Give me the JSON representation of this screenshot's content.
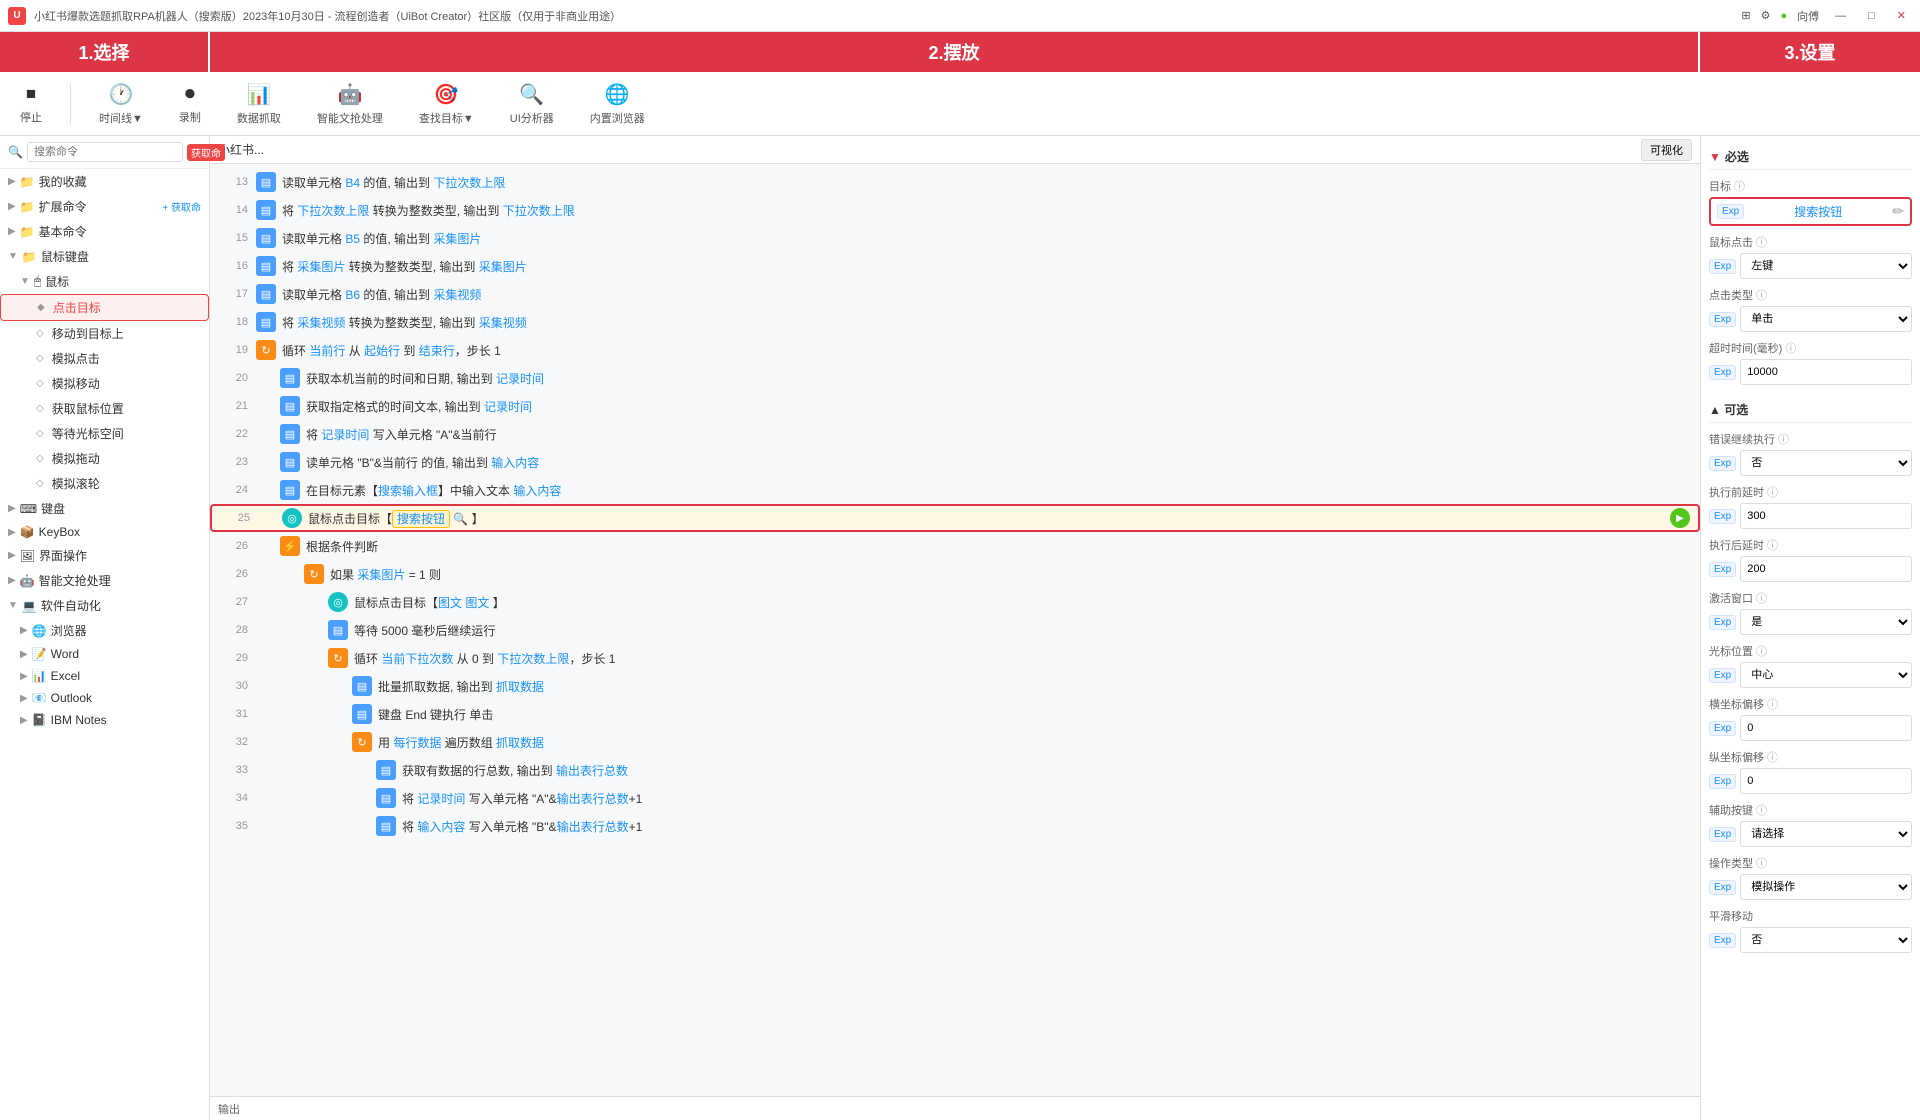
{
  "titlebar": {
    "icon": "U",
    "title": "小红书爆款选题抓取RPA机器人（搜索版）2023年10月30日 - 流程创造者（UiBot Creator）社区版（仅用于非商业用途）",
    "controls": [
      "最小化",
      "最大化",
      "关闭"
    ],
    "right": {
      "grid_icon": "⊞",
      "user": "向傅",
      "dot_color": "#52c41a"
    }
  },
  "toolbar": {
    "items": [
      {
        "id": "stop",
        "label": "停止",
        "icon": "⏹"
      },
      {
        "id": "time",
        "label": "时间线▼",
        "icon": "🕐"
      },
      {
        "id": "record",
        "label": "录制",
        "icon": "⏺"
      },
      {
        "id": "extract",
        "label": "数据抓取",
        "icon": "📊"
      },
      {
        "id": "ai_text",
        "label": "智能文抢处理",
        "icon": "🤖"
      },
      {
        "id": "find_target",
        "label": "查找目标▼",
        "icon": "🎯"
      },
      {
        "id": "ui_analyzer",
        "label": "UI分析器",
        "icon": "🔍"
      },
      {
        "id": "browser",
        "label": "内置浏览器",
        "icon": "🌐"
      }
    ]
  },
  "left_panel": {
    "search_placeholder": "搜索命令",
    "badge": "获取命",
    "sections": [
      {
        "id": "favorites",
        "label": "我的收藏",
        "level": 0,
        "collapsed": true
      },
      {
        "id": "extensions",
        "label": "扩展命令",
        "level": 0,
        "collapsed": true
      },
      {
        "id": "basic",
        "label": "基本命令",
        "level": 0,
        "collapsed": true
      },
      {
        "id": "mouse_keyboard",
        "label": "鼠标键盘",
        "level": 0,
        "collapsed": false
      },
      {
        "id": "mouse",
        "label": "鼠标",
        "level": 1,
        "collapsed": false
      },
      {
        "id": "click_target",
        "label": "点击目标",
        "level": 2,
        "active": true
      },
      {
        "id": "move_to_target",
        "label": "移动到目标上",
        "level": 2
      },
      {
        "id": "simulate_click",
        "label": "模拟点击",
        "level": 2
      },
      {
        "id": "simulate_move",
        "label": "模拟移动",
        "level": 2
      },
      {
        "id": "get_mouse_pos",
        "label": "获取鼠标位置",
        "level": 2
      },
      {
        "id": "wait_cursor",
        "label": "等待光标空间",
        "level": 2
      },
      {
        "id": "simulate_drag",
        "label": "模拟拖动",
        "level": 2
      },
      {
        "id": "simulate_scroll",
        "label": "模拟滚轮",
        "level": 2
      },
      {
        "id": "keyboard",
        "label": "键盘",
        "level": 0,
        "collapsed": true
      },
      {
        "id": "keybox",
        "label": "KeyBox",
        "level": 0,
        "collapsed": true
      },
      {
        "id": "ui_ops",
        "label": "界面操作",
        "level": 0,
        "collapsed": true
      },
      {
        "id": "ai_text2",
        "label": "智能文抢处理",
        "level": 0,
        "collapsed": true
      },
      {
        "id": "software_auto",
        "label": "软件自动化",
        "level": 0,
        "collapsed": false
      },
      {
        "id": "browser2",
        "label": "浏览器",
        "level": 1,
        "collapsed": true
      },
      {
        "id": "word",
        "label": "Word",
        "level": 1,
        "collapsed": true
      },
      {
        "id": "excel",
        "label": "Excel",
        "level": 1,
        "collapsed": true
      },
      {
        "id": "outlook",
        "label": "Outlook",
        "level": 1,
        "collapsed": true
      },
      {
        "id": "ibm_notes",
        "label": "IBM Notes",
        "level": 1,
        "collapsed": true
      }
    ],
    "section_label": "1.选择"
  },
  "center_panel": {
    "breadcrumb": "小红书...",
    "vis_btn": "可视化",
    "section_label": "2.摆放",
    "rows": [
      {
        "num": 13,
        "icon_type": "blue",
        "icon": "▤",
        "content": "读取单元格 B4 的值, 输出到 下拉次数上限",
        "vars": [
          "B4",
          "下拉次数上限"
        ]
      },
      {
        "num": 14,
        "icon_type": "blue",
        "icon": "▤",
        "content": "将 下拉次数上限 转换为整数类型, 输出到 下拉次数上限",
        "vars": [
          "下拉次数上限",
          "下拉次数上限"
        ]
      },
      {
        "num": 15,
        "icon_type": "blue",
        "icon": "▤",
        "content": "读取单元格 B5 的值, 输出到 采集图片",
        "vars": [
          "B5",
          "采集图片"
        ]
      },
      {
        "num": 16,
        "icon_type": "blue",
        "icon": "▤",
        "content": "将 采集图片 转换为整数类型, 输出到 采集图片",
        "vars": [
          "采集图片",
          "采集图片"
        ]
      },
      {
        "num": 17,
        "icon_type": "blue",
        "icon": "▤",
        "content": "读取单元格 B6 的值, 输出到 采集视频",
        "vars": [
          "B6",
          "采集视频"
        ]
      },
      {
        "num": 18,
        "icon_type": "blue",
        "icon": "▤",
        "content": "将 采集视频 转换为整数类型, 输出到 采集视频",
        "vars": [
          "采集视频",
          "采集视频"
        ]
      },
      {
        "num": 19,
        "icon_type": "orange",
        "icon": "↻",
        "content": "循环 当前行 从 起始行 到 结束行，步长 1",
        "vars": [
          "当前行",
          "起始行",
          "结束行"
        ]
      },
      {
        "num": 20,
        "icon_type": "blue",
        "icon": "▤",
        "content": "获取本机当前的时间和日期, 输出到 记录时间",
        "indent": 1,
        "vars": [
          "记录时间"
        ]
      },
      {
        "num": 21,
        "icon_type": "blue",
        "icon": "▤",
        "content": "获取指定格式的时间文本, 输出到 记录时间",
        "indent": 1,
        "vars": [
          "记录时间"
        ]
      },
      {
        "num": 22,
        "icon_type": "blue",
        "icon": "▤",
        "content": "将 记录时间 写入单元格 \"A\"&当前行",
        "indent": 1,
        "vars": [
          "记录时间",
          "A",
          "当前行"
        ]
      },
      {
        "num": 23,
        "icon_type": "blue",
        "icon": "▤",
        "content": "读单元格 \"B\"&当前行 的值, 输出到 输入内容",
        "indent": 1,
        "vars": [
          "B",
          "当前行",
          "输入内容"
        ]
      },
      {
        "num": 24,
        "icon_type": "blue",
        "icon": "▤",
        "content": "在目标元素【搜索输入框】中输入文本 输入内容",
        "indent": 1,
        "vars": [
          "搜索输入框",
          "输入内容"
        ]
      },
      {
        "num": 25,
        "icon_type": "cyan",
        "icon": "◎",
        "content": "鼠标点击目标【搜索按钮 🔍 】",
        "indent": 1,
        "active": true,
        "vars": [
          "搜索按钮"
        ]
      },
      {
        "num": 26,
        "icon_type": "orange",
        "icon": "⚡",
        "content": "根据条件判断",
        "indent": 1
      },
      {
        "num": "26",
        "icon_type": "orange",
        "icon": "↻",
        "sub": true,
        "content": "如果 采集图片 = 1 则",
        "indent": 2,
        "vars": [
          "采集图片"
        ]
      },
      {
        "num": 27,
        "icon_type": "cyan",
        "icon": "◎",
        "content": "鼠标点击目标【图文 图文 】",
        "indent": 3,
        "vars": [
          "图文",
          "图文"
        ]
      },
      {
        "num": 28,
        "icon_type": "blue",
        "icon": "▤",
        "content": "等待 5000 毫秒后继续运行",
        "indent": 3
      },
      {
        "num": 29,
        "icon_type": "orange",
        "icon": "↻",
        "content": "循环 当前下拉次数 从 0 到 下拉次数上限，步长 1",
        "indent": 3,
        "vars": [
          "当前下拉次数",
          "下拉次数上限"
        ]
      },
      {
        "num": 30,
        "icon_type": "blue",
        "icon": "▤",
        "content": "批量抓取数据, 输出到 抓取数据",
        "indent": 4,
        "vars": [
          "抓取数据"
        ]
      },
      {
        "num": 31,
        "icon_type": "blue",
        "icon": "▤",
        "content": "键盘 End 键执行 单击",
        "indent": 4
      },
      {
        "num": 32,
        "icon_type": "orange",
        "icon": "↻",
        "content": "用 每行数据 遍历数组 抓取数据",
        "indent": 4,
        "vars": [
          "每行数据",
          "抓取数据"
        ]
      },
      {
        "num": 33,
        "icon_type": "blue",
        "icon": "▤",
        "content": "获取有数据的行总数, 输出到 输出表行总数",
        "indent": 5,
        "vars": [
          "输出表行总数"
        ]
      },
      {
        "num": 34,
        "icon_type": "blue",
        "icon": "▤",
        "content": "将 记录时间 写入单元格 \"A\"&输出表行总数+1",
        "indent": 5,
        "vars": [
          "记录时间",
          "A",
          "输出表行总数"
        ]
      },
      {
        "num": 35,
        "icon_type": "blue",
        "icon": "▤",
        "content": "将 输入内容 写入单元格 \"B\"&输出表行总数+1",
        "indent": 5,
        "vars": [
          "输入内容",
          "B",
          "输出表行总数"
        ]
      }
    ],
    "footer": "输出"
  },
  "right_panel": {
    "section_label": "3.设置",
    "required_title": "必选",
    "optional_title": "▲ 可选",
    "fields": {
      "target_label": "目标",
      "target_value": "搜索按钮",
      "mouse_click_label": "鼠标点击",
      "mouse_click_value": "左键",
      "click_type_label": "点击类型",
      "click_type_value": "单击",
      "timeout_label": "超时时间(毫秒)",
      "timeout_value": "10000",
      "error_continue_label": "错误继续执行",
      "error_continue_value": "否",
      "exec_delay1_label": "执行前延时",
      "exec_delay1_value": "300",
      "exec_delay2_label": "执行后延时",
      "exec_delay2_value": "200",
      "activate_window_label": "激活窗口",
      "activate_window_value": "是",
      "cursor_pos_label": "光标位置",
      "cursor_pos_value": "中心",
      "x_offset_label": "横坐标偏移",
      "x_offset_value": "0",
      "y_offset_label": "纵坐标偏移",
      "y_offset_value": "0",
      "hotkey_label": "辅助按键",
      "hotkey_value": "请选择",
      "op_type_label": "操作类型",
      "op_type_value": "模拟操作",
      "smooth_label": "平滑移动",
      "smooth_value": "否"
    }
  }
}
